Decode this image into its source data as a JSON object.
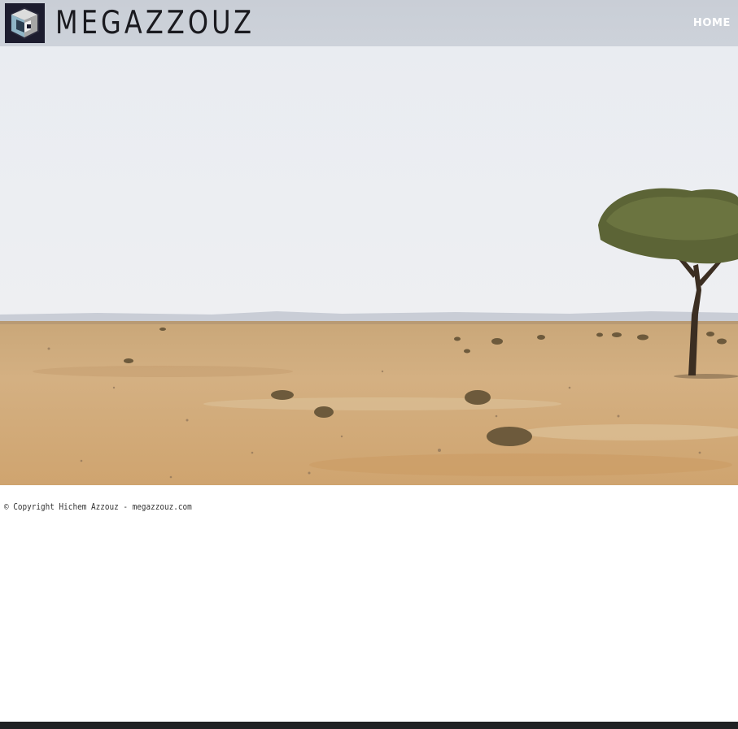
{
  "header": {
    "logo_text": "MEGAZZOUZ",
    "logo_icon": "cube-logo-icon",
    "background_color": "#cbd0d8"
  },
  "nav": {
    "items": [
      {
        "label": "HOME"
      }
    ]
  },
  "hero": {
    "image": "desert-landscape-with-acacia-tree",
    "sky_color": "#eef0f4",
    "sand_color": "#d2ac78"
  },
  "footer": {
    "copyright": "© Copyright Hichem Azzouz - megazzouz.com",
    "bar_color": "#1f2123"
  }
}
